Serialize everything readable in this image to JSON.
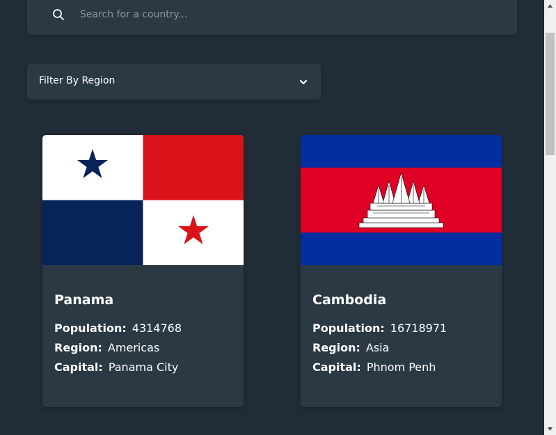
{
  "search": {
    "placeholder": "Search for a country...",
    "icon": "search-icon"
  },
  "filter": {
    "label": "Filter By Region",
    "icon": "chevron-down-icon"
  },
  "labels": {
    "population": "Population:",
    "region": "Region:",
    "capital": "Capital:"
  },
  "countries": [
    {
      "name": "Panama",
      "population": "4314768",
      "region": "Americas",
      "capital": "Panama City"
    },
    {
      "name": "Cambodia",
      "population": "16718971",
      "region": "Asia",
      "capital": "Phnom Penh"
    }
  ],
  "colors": {
    "background": "#202c37",
    "element": "#2b3945",
    "text": "#ffffff",
    "placeholder": "#8a96a3"
  }
}
